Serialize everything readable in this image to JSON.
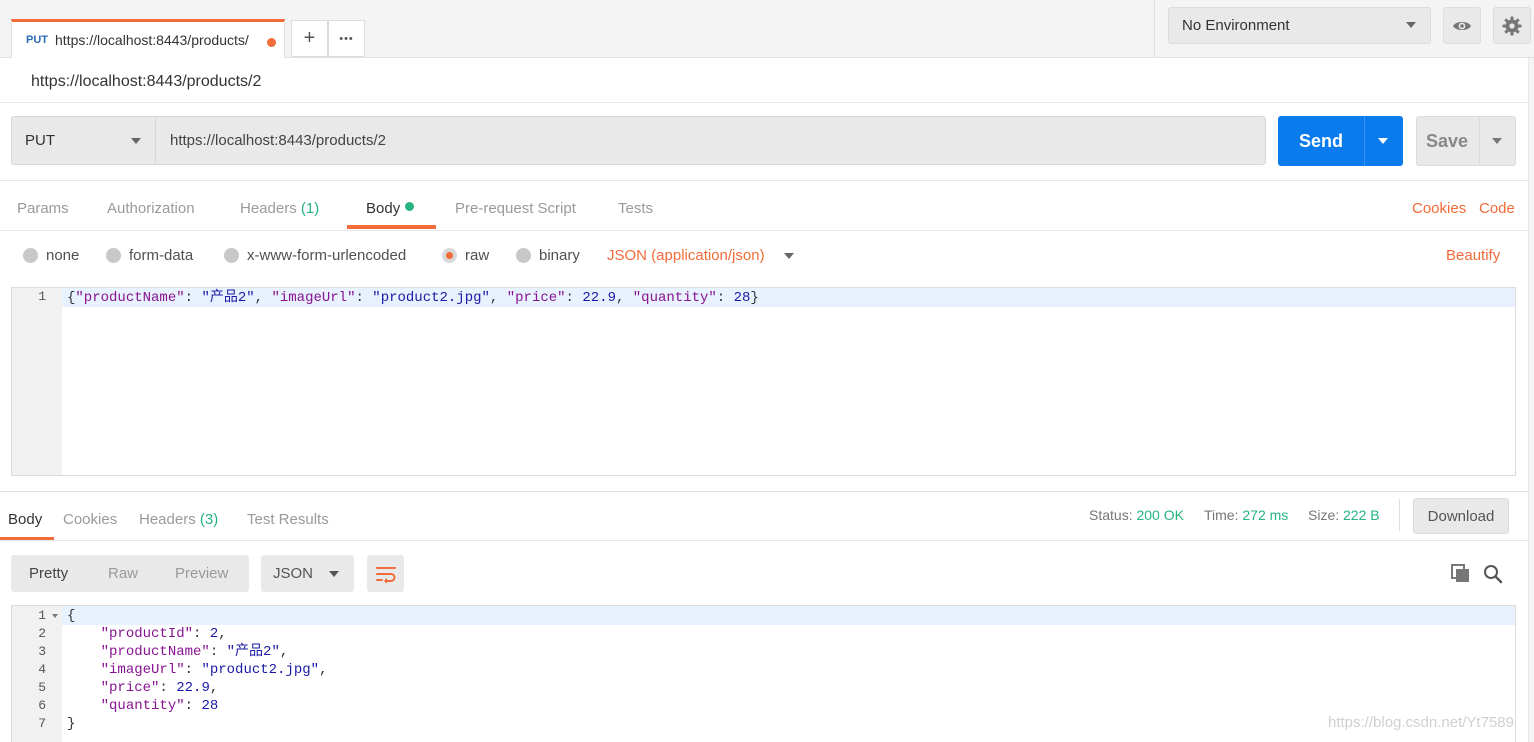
{
  "request_tab": {
    "method": "PUT",
    "url": "https://localhost:8443/products/"
  },
  "tab_controls": {
    "add_label": "+",
    "more_label": "•••"
  },
  "environment": {
    "selected": "No Environment"
  },
  "request_title": "https://localhost:8443/products/2",
  "url_bar": {
    "method": "PUT",
    "url": "https://localhost:8443/products/2",
    "send_label": "Send",
    "save_label": "Save"
  },
  "request_tabs": {
    "params": "Params",
    "authorization": "Authorization",
    "headers": "Headers",
    "headers_count": "(1)",
    "body": "Body",
    "prerequest": "Pre-request Script",
    "tests": "Tests",
    "cookies": "Cookies",
    "code": "Code"
  },
  "body_types": {
    "none": "none",
    "form_data": "form-data",
    "urlencoded": "x-www-form-urlencoded",
    "raw": "raw",
    "binary": "binary",
    "selected": "raw",
    "content_type": "JSON (application/json)",
    "beautify": "Beautify"
  },
  "request_body": {
    "line_number": "1",
    "tokens": {
      "open": "{",
      "k1": "\"productName\"",
      "v1": "\"产品2\"",
      "k2": "\"imageUrl\"",
      "v2": "\"product2.jpg\"",
      "k3": "\"price\"",
      "v3": "22.9",
      "k4": "\"quantity\"",
      "v4": "28",
      "close": "}"
    }
  },
  "response_tabs": {
    "body": "Body",
    "cookies": "Cookies",
    "headers": "Headers",
    "headers_count": "(3)",
    "test_results": "Test Results"
  },
  "response_meta": {
    "status_label": "Status:",
    "status_value": "200 OK",
    "time_label": "Time:",
    "time_value": "272 ms",
    "size_label": "Size:",
    "size_value": "222 B",
    "download_label": "Download"
  },
  "response_view": {
    "pretty": "Pretty",
    "raw": "Raw",
    "preview": "Preview",
    "format": "JSON"
  },
  "response_body": {
    "line_numbers": [
      "1",
      "2",
      "3",
      "4",
      "5",
      "6",
      "7"
    ],
    "open": "{",
    "close": "}",
    "fields": [
      {
        "key": "\"productId\"",
        "value": "2",
        "comma": ","
      },
      {
        "key": "\"productName\"",
        "value": "\"产品2\"",
        "comma": ","
      },
      {
        "key": "\"imageUrl\"",
        "value": "\"product2.jpg\"",
        "comma": ","
      },
      {
        "key": "\"price\"",
        "value": "22.9",
        "comma": ","
      },
      {
        "key": "\"quantity\"",
        "value": "28",
        "comma": ""
      }
    ]
  },
  "watermark": "https://blog.csdn.net/Yt7589",
  "colors": {
    "accent": "#f26b3a",
    "send": "#097bed",
    "success": "#26b47f",
    "json_key": "#881391",
    "json_value": "#1a1aa6"
  }
}
